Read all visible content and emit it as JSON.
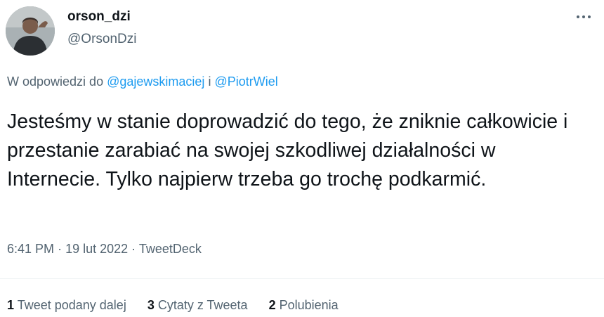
{
  "tweet": {
    "author": {
      "display_name": "orson_dzi",
      "handle": "@OrsonDzi"
    },
    "reply_context": {
      "prefix": "W odpowiedzi do",
      "users": [
        "@gajewskimaciej",
        "@PiotrWiel"
      ],
      "joiner": "i"
    },
    "text": "Jesteśmy w stanie doprowadzić do tego, że zniknie całkowicie i przestanie zarabiać na swojej szkodliwej działalności w Internecie. Tylko najpierw trzeba go trochę podkarmić.",
    "time": "6:41 PM",
    "separator": "·",
    "date": "19 lut 2022",
    "source": "TweetDeck",
    "stats": {
      "retweets_count": "1",
      "retweets_label": "Tweet podany dalej",
      "quotes_count": "3",
      "quotes_label": "Cytaty z Tweeta",
      "likes_count": "2",
      "likes_label": "Polubienia"
    }
  },
  "colors": {
    "text_primary": "#0f1419",
    "text_secondary": "#536471",
    "link": "#1d9bf0",
    "divider": "#eff3f4"
  },
  "icons": {
    "more": "more-horizontal-icon"
  }
}
